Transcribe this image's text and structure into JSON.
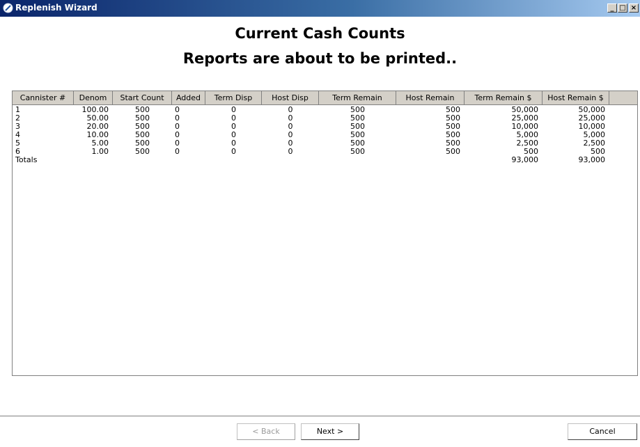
{
  "window": {
    "title": "Replenish Wizard",
    "controls": {
      "minimize": "_",
      "maximize": "□",
      "close": "×"
    }
  },
  "heading": {
    "line1": "Current Cash Counts",
    "line2": "Reports are about to be printed.."
  },
  "table": {
    "columns": [
      "Cannister #",
      "Denom",
      "Start Count",
      "Added",
      "Term Disp",
      "Host Disp",
      "Term Remain",
      "Host Remain",
      "Term Remain $",
      "Host Remain $"
    ],
    "rows": [
      [
        "1",
        "100.00",
        "500",
        "0",
        "0",
        "0",
        "500",
        "500",
        "50,000",
        "50,000"
      ],
      [
        "2",
        "50.00",
        "500",
        "0",
        "0",
        "0",
        "500",
        "500",
        "25,000",
        "25,000"
      ],
      [
        "3",
        "20.00",
        "500",
        "0",
        "0",
        "0",
        "500",
        "500",
        "10,000",
        "10,000"
      ],
      [
        "4",
        "10.00",
        "500",
        "0",
        "0",
        "0",
        "500",
        "500",
        "5,000",
        "5,000"
      ],
      [
        "5",
        "5.00",
        "500",
        "0",
        "0",
        "0",
        "500",
        "500",
        "2,500",
        "2,500"
      ],
      [
        "6",
        "1.00",
        "500",
        "0",
        "0",
        "0",
        "500",
        "500",
        "500",
        "500"
      ]
    ],
    "totals": [
      "Totals",
      "",
      "",
      "",
      "",
      "",
      "",
      "",
      "93,000",
      "93,000"
    ]
  },
  "buttons": {
    "back": "< Back",
    "next": "Next >",
    "cancel": "Cancel"
  },
  "colors": {
    "titlebar_start": "#0a246a",
    "titlebar_end": "#a6caf0",
    "disabled_text": "#9a9a9a"
  }
}
